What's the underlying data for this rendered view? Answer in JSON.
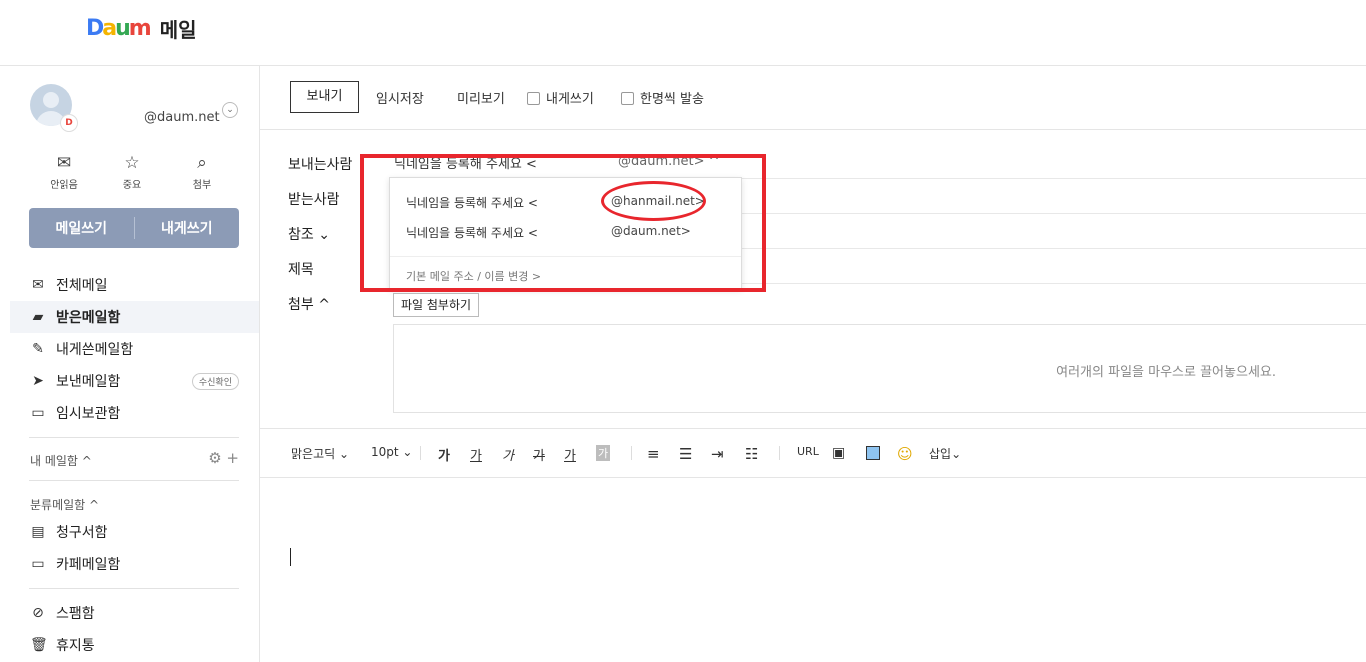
{
  "app": {
    "logo": "Daum",
    "title": "메일"
  },
  "account": {
    "email": "@daum.net",
    "badge": "D"
  },
  "quick_actions": [
    {
      "label": "안읽음",
      "icon": "envelope-icon"
    },
    {
      "label": "중요",
      "icon": "star-icon"
    },
    {
      "label": "첨부",
      "icon": "paperclip-icon"
    }
  ],
  "write": {
    "compose": "메일쓰기",
    "self": "내게쓰기"
  },
  "nav": {
    "all": "전체메일",
    "inbox": "받은메일함",
    "self_sent": "내게쓴메일함",
    "sent": "보낸메일함",
    "sent_badge": "수신확인",
    "drafts": "임시보관함"
  },
  "my_folders": {
    "title": "내 메일함 ^"
  },
  "categories": {
    "title": "분류메일함 ^",
    "bills": "청구서함",
    "cafe": "카페메일함"
  },
  "misc": {
    "spam": "스팸함",
    "trash": "휴지통"
  },
  "toolbar": {
    "send": "보내기",
    "save_draft": "임시저장",
    "preview": "미리보기",
    "write_self": "내게쓰기",
    "send_individually": "한명씩 발송"
  },
  "fields": {
    "from": "보내는사람",
    "to": "받는사람",
    "cc": "참조",
    "subject": "제목",
    "attach": "첨부",
    "from_value": "닉네임을 등록해 주세요 <",
    "from_email": "@daum.net> ^"
  },
  "sender_dropdown": {
    "options": [
      {
        "name": "닉네임을 등록해 주세요 <",
        "email": "@hanmail.net>"
      },
      {
        "name": "닉네임을 등록해 주세요 <",
        "email": "@daum.net>"
      }
    ],
    "footer": "기본 메일 주소 / 이름 변경 >"
  },
  "attachment": {
    "button": "파일 첨부하기",
    "hint": "여러개의 파일을 마우스로 끌어놓으세요."
  },
  "editor": {
    "font": "맑은고딕",
    "size": "10pt",
    "bold": "가",
    "underline": "가",
    "italic": "가",
    "strike": "가",
    "font_color": "가",
    "bg_color": "가",
    "url": "URL",
    "insert": "삽입"
  },
  "colors": {
    "accent_button": "#8c9bb6",
    "highlight": "#e8262d"
  }
}
